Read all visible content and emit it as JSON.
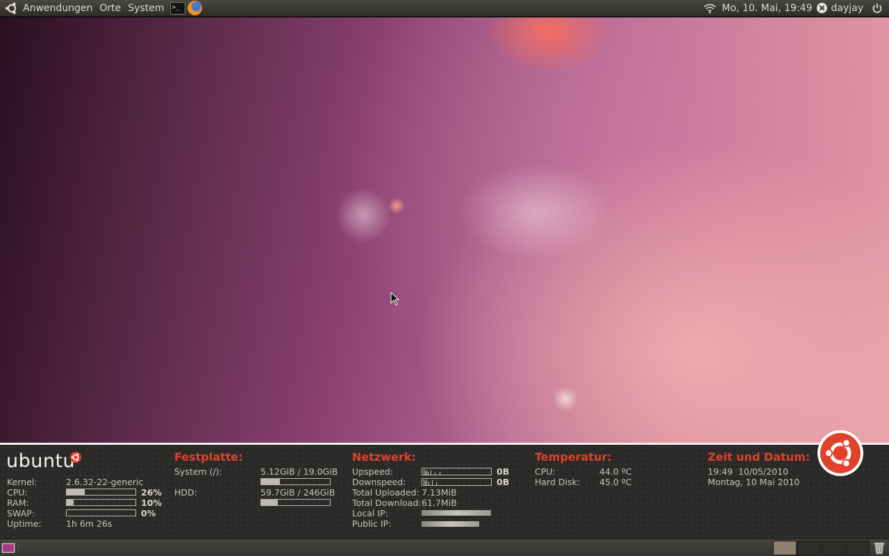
{
  "top_panel": {
    "menus": [
      "Anwendungen",
      "Orte",
      "System"
    ],
    "launchers": [
      {
        "name": "terminal",
        "glyph": ">_"
      },
      {
        "name": "firefox",
        "glyph": ""
      }
    ],
    "datetime": "Mo, 10. Mai, 19:49",
    "user": "dayjay",
    "icons": [
      "ubuntu-logo-icon",
      "wifi-icon",
      "close-icon",
      "power-icon"
    ]
  },
  "conky": {
    "logo_text": "ubuntu",
    "system": {
      "rows": [
        {
          "label": "Kernel:",
          "value": "2.6.32-22-generic"
        },
        {
          "label": "CPU:",
          "value": "26%",
          "level": 26
        },
        {
          "label": "RAM:",
          "value": "10%",
          "level": 10
        },
        {
          "label": "SWAP:",
          "value": "0%",
          "level": 0
        },
        {
          "label": "Uptime:",
          "value": "1h 6m 26s"
        }
      ]
    },
    "disk": {
      "title": "Festplatte:",
      "rows": [
        {
          "label": "System (/):",
          "value": "5.12GiB / 19.0GiB",
          "level": 27
        },
        {
          "label": "HDD:",
          "value": "59.7GiB / 246GiB",
          "level": 24
        }
      ]
    },
    "network": {
      "title": "Netzwerk:",
      "upspeed_label": "Upspeed:",
      "upspeed_value": "0B",
      "downspeed_label": "Downspeed:",
      "downspeed_value": "0B",
      "total_up_label": "Total Uploaded:",
      "total_up_value": "7.13MiB",
      "total_down_label": "Total Download:",
      "total_down_value": "61.7MiB",
      "local_ip_label": "Local IP:",
      "public_ip_label": "Public IP:"
    },
    "temperature": {
      "title": "Temperatur:",
      "cpu_label": "CPU:",
      "cpu_value": "44.0 ºC",
      "hdd_label": "Hard Disk:",
      "hdd_value": "45.0 ºC"
    },
    "time": {
      "title": "Zeit und Datum:",
      "line1": "19:49  10/05/2010",
      "line2": "Montag, 10 Mai 2010"
    }
  },
  "bottom_panel": {
    "workspaces": 4,
    "active_workspace": 1
  },
  "colors": {
    "accent": "#e0422c",
    "conky_bg": "#2b2a28",
    "panel_bg": "#3a3935"
  }
}
